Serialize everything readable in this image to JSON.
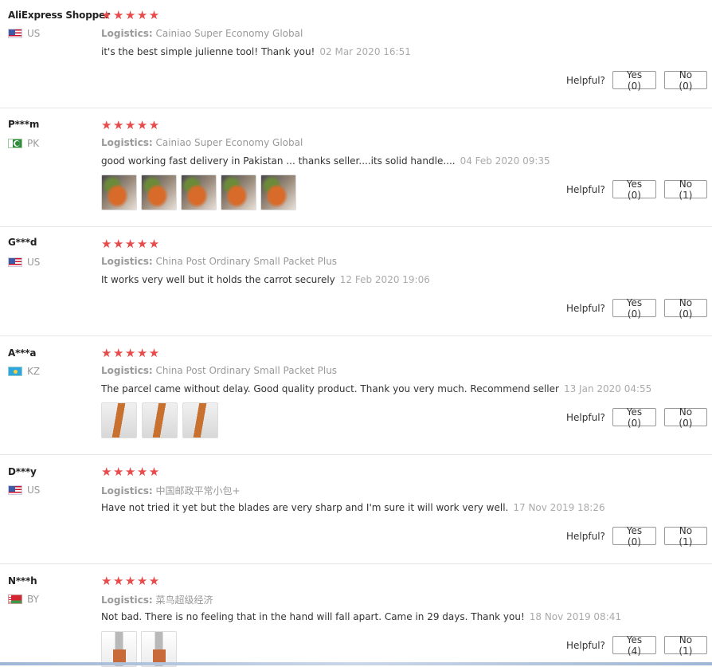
{
  "helpful_label": "Helpful?",
  "reviews": [
    {
      "user": "AliExpress Shopper",
      "country": "US",
      "flag": "us-flag-icon",
      "stars": "★★★★★",
      "rating": 5,
      "logistics_label": "Logistics:",
      "logistics": "Cainiao Super Economy Global",
      "text": "it's the best simple julienne tool! Thank you!",
      "date": "02 Mar 2020 16:51",
      "yes": "Yes (0)",
      "no": "No (0)",
      "photos": 0
    },
    {
      "user": "P***m",
      "country": "PK",
      "flag": "pk-flag-icon",
      "stars": "★★★★★",
      "rating": 5,
      "logistics_label": "Logistics:",
      "logistics": "Cainiao Super Economy Global",
      "text": "good working fast delivery in Pakistan ... thanks seller....its solid handle....",
      "date": "04 Feb 2020 09:35",
      "yes": "Yes (0)",
      "no": "No (1)",
      "photos": 5
    },
    {
      "user": "G***d",
      "country": "US",
      "flag": "us-flag-icon",
      "stars": "★★★★★",
      "rating": 5,
      "logistics_label": "Logistics:",
      "logistics": "China Post Ordinary Small Packet Plus",
      "text": "It works very well but it holds the carrot securely",
      "date": "12 Feb 2020 19:06",
      "yes": "Yes (0)",
      "no": "No (0)",
      "photos": 0
    },
    {
      "user": "A***a",
      "country": "KZ",
      "flag": "kz-flag-icon",
      "stars": "★★★★★",
      "rating": 5,
      "logistics_label": "Logistics:",
      "logistics": "China Post Ordinary Small Packet Plus",
      "text": "The parcel came without delay. Good quality product. Thank you very much. Recommend seller",
      "date": "13 Jan 2020 04:55",
      "yes": "Yes (0)",
      "no": "No (0)",
      "photos": 3
    },
    {
      "user": "D***y",
      "country": "US",
      "flag": "us-flag-icon",
      "stars": "★★★★★",
      "rating": 5,
      "logistics_label": "Logistics:",
      "logistics": "中国邮政平常小包+",
      "text": "Have not tried it yet but the blades are very sharp and I'm sure it will work very well.",
      "date": "17 Nov 2019 18:26",
      "yes": "Yes (0)",
      "no": "No (1)",
      "photos": 0
    },
    {
      "user": "N***h",
      "country": "BY",
      "flag": "by-flag-icon",
      "stars": "★★★★★",
      "rating": 5,
      "logistics_label": "Logistics:",
      "logistics": "菜鸟超级经济",
      "text": "Not bad. There is no feeling that in the hand will fall apart. Came in 29 days. Thank you!",
      "date": "18 Nov 2019 08:41",
      "yes": "Yes (4)",
      "no": "No (1)",
      "photos": 2
    }
  ]
}
